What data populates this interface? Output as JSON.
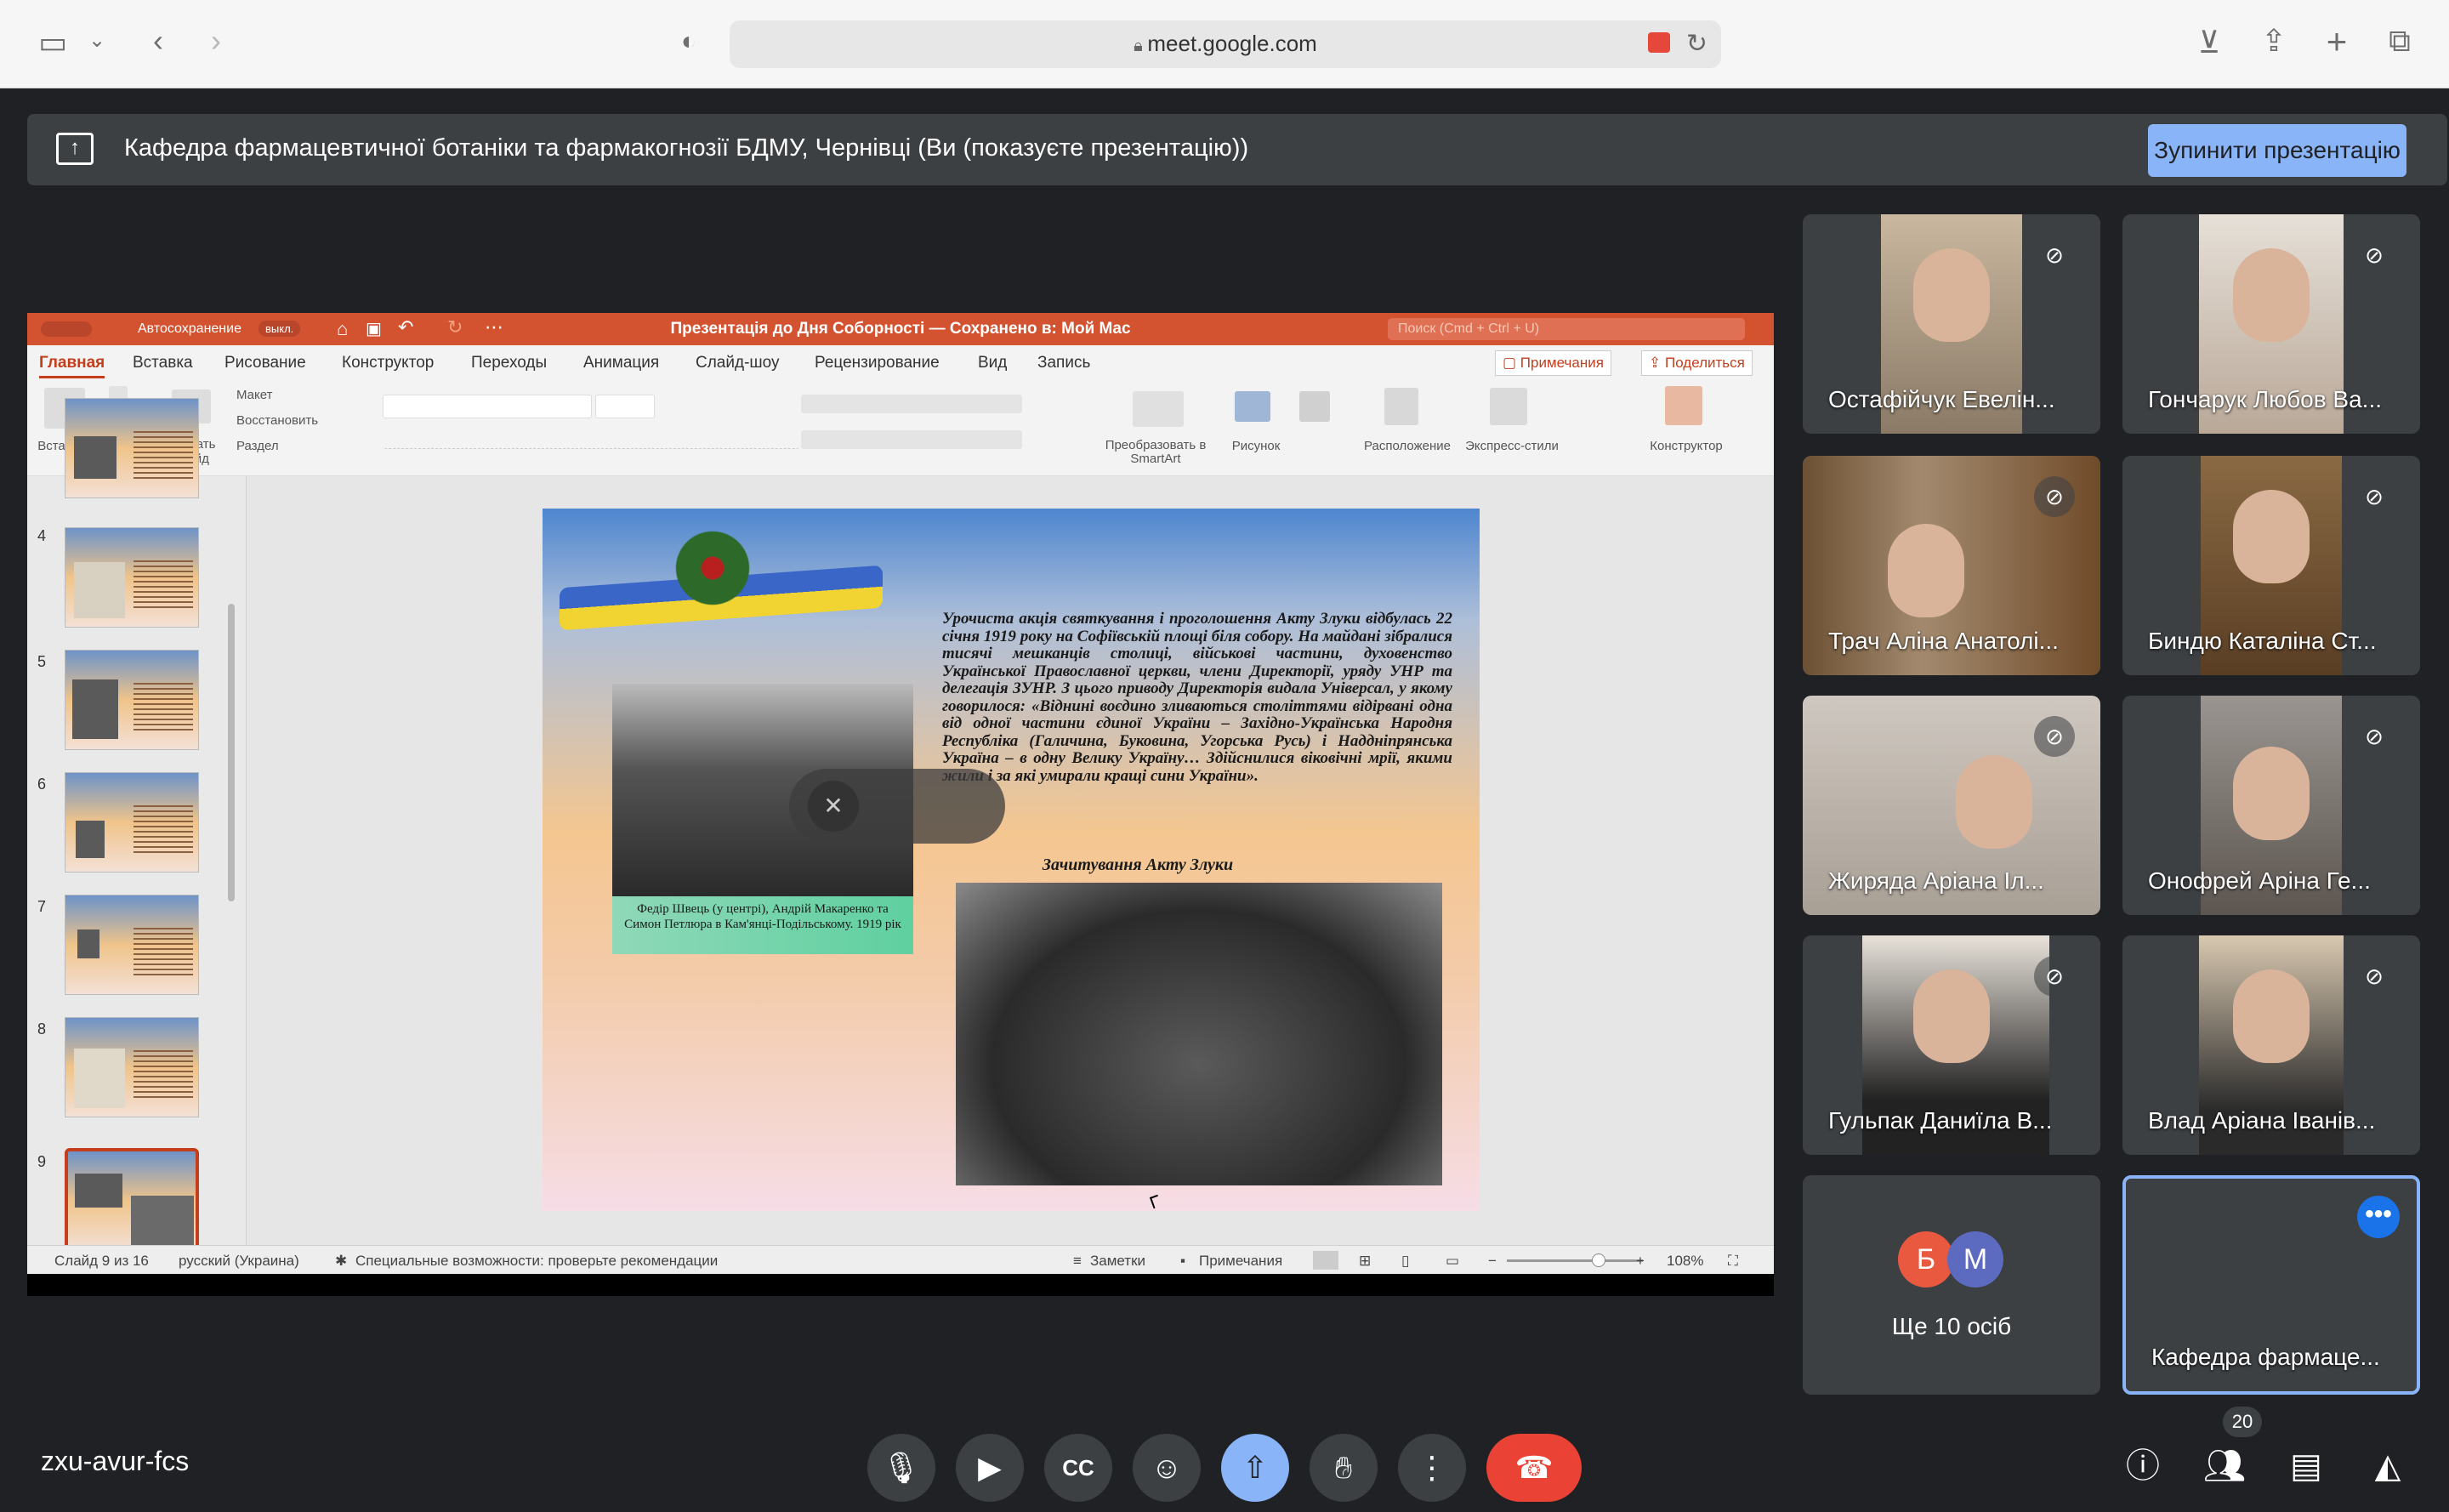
{
  "browser": {
    "url": "meet.google.com"
  },
  "banner": {
    "text": "Кафедра фармацевтичної ботаніки та фармакогнозії БДМУ, Чернівці (Ви (показуєте презентацію))",
    "stop_label": "Зупинити презентацію"
  },
  "ppt": {
    "autosave_label": "Автосохранение",
    "autosave_state": "выкл.",
    "title": "Презентація до Дня Соборності — Сохранено в: Мой Mac",
    "search_placeholder": "Поиск (Cmd + Ctrl + U)",
    "tabs": [
      "Главная",
      "Вставка",
      "Рисование",
      "Конструктор",
      "Переходы",
      "Анимация",
      "Слайд-шоу",
      "Рецензирование",
      "Вид",
      "Запись"
    ],
    "comments_btn": "Примечания",
    "share_btn": "Поделиться",
    "ribbon": {
      "paste": "Вставить",
      "new_slide": "Создать слайд",
      "layout": "Макет",
      "reset": "Восстановить",
      "section": "Раздел",
      "smartart": "Преобразовать в SmartArt",
      "picture": "Рисунок",
      "arrange": "Расположение",
      "quick_styles": "Экспресс-стили",
      "designer": "Конструктор"
    },
    "thumbnails": [
      "4",
      "5",
      "6",
      "7",
      "8",
      "9"
    ],
    "slide": {
      "paragraph": "Урочиста акція святкування і проголошення Акту Злуки відбулась 22 січня 1919 року на Софіївській площі біля собору. На майдані зібралися тисячі мешканців столиці, військові частини, духовенство Української Православної церкви, члени Директорії, уряду УНР та делегація ЗУНР. З цього приводу Директорія видала Універсал, у якому говорилося: «Віднині воєдино зливаються століттями відірвані одна від одної частини єдиної України – Західно-Українська Народня Республіка (Галичина, Буковина, Угорська Русь) і Наддніпрянська Україна – в одну Велику Україну… Здійснилися віковічні мрії, якими жили і за які умирали кращі сини України».",
      "caption_left": "Федір Швець (у центрі), Андрій Макаренко та Симон Петлюра в Кам'янці-Подільському. 1919 рік",
      "caption_right": "Зачитування Акту Злуки"
    },
    "status": {
      "slide_of": "Слайд 9 из 16",
      "language": "русский (Украина)",
      "accessibility": "Специальные возможности: проверьте рекомендации",
      "notes": "Заметки",
      "comments": "Примечания",
      "zoom": "108%"
    }
  },
  "participants": [
    {
      "name": "Остафійчук Евелін..."
    },
    {
      "name": "Гончарук Любов Ва..."
    },
    {
      "name": "Трач Аліна Анатолі..."
    },
    {
      "name": "Биндю Каталіна Ст..."
    },
    {
      "name": "Жиряда Аріана Іл..."
    },
    {
      "name": "Онофрей Аріна Ге..."
    },
    {
      "name": "Гульпак Даниїла В..."
    },
    {
      "name": "Влад Аріана Іванів..."
    }
  ],
  "more_tile": {
    "avatar1": "Б",
    "avatar2": "М",
    "avatar1_color": "#e8593f",
    "avatar2_color": "#5c6bc0",
    "label": "Ще 10 осіб"
  },
  "self_tile": {
    "name": "Кафедра фармаце..."
  },
  "meeting": {
    "code": "zxu-avur-fcs",
    "participant_count": "20"
  },
  "colors": {
    "meet_bg": "#202124",
    "accent_blue": "#8ab4f8",
    "end_call_red": "#ea4335",
    "ppt_orange": "#d35230"
  }
}
